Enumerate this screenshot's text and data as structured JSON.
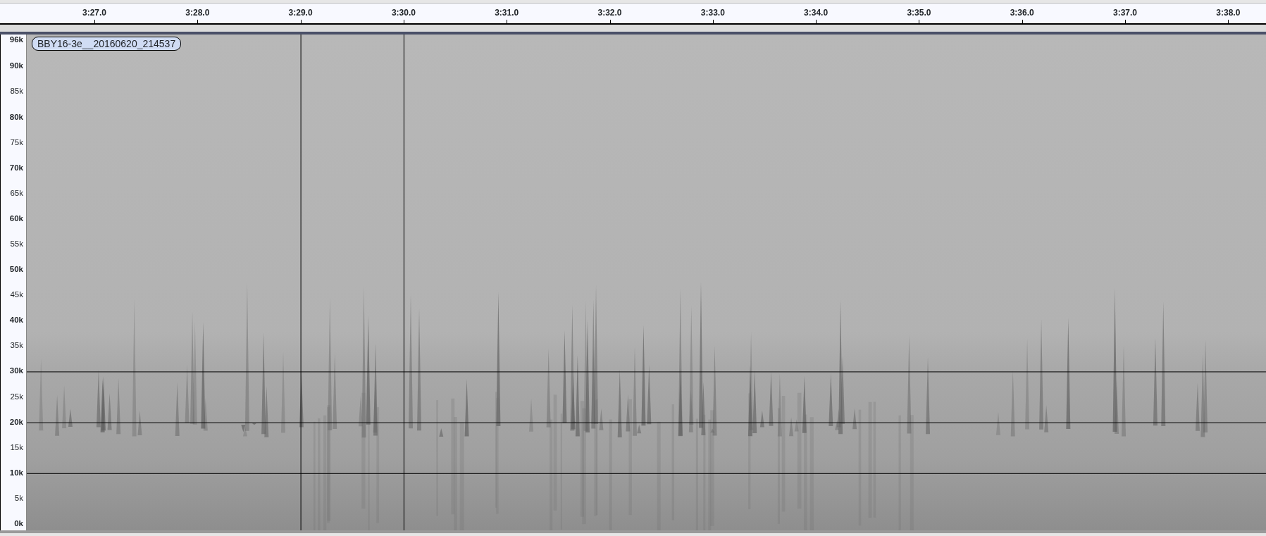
{
  "ruler": {
    "ticks": [
      "3:27.0",
      "3:28.0",
      "3:29.0",
      "3:30.0",
      "3:31.0",
      "3:32.0",
      "3:33.0",
      "3:34.0",
      "3:35.0",
      "3:36.0",
      "3:37.0",
      "3:38.0"
    ]
  },
  "track": {
    "clip_label": "BBY16-3e__20160620_214537",
    "axis_labels": [
      {
        "text": "96k",
        "major": true
      },
      {
        "text": "90k",
        "major": true
      },
      {
        "text": "85k",
        "major": false
      },
      {
        "text": "80k",
        "major": true
      },
      {
        "text": "75k",
        "major": false
      },
      {
        "text": "70k",
        "major": true
      },
      {
        "text": "65k",
        "major": false
      },
      {
        "text": "60k",
        "major": true
      },
      {
        "text": "55k",
        "major": false
      },
      {
        "text": "50k",
        "major": true
      },
      {
        "text": "45k",
        "major": false
      },
      {
        "text": "40k",
        "major": true
      },
      {
        "text": "35k",
        "major": false
      },
      {
        "text": "30k",
        "major": true
      },
      {
        "text": "25k",
        "major": false
      },
      {
        "text": "20k",
        "major": true
      },
      {
        "text": "15k",
        "major": false
      },
      {
        "text": "10k",
        "major": true
      },
      {
        "text": "5k",
        "major": false
      },
      {
        "text": "0k",
        "major": true
      }
    ]
  }
}
